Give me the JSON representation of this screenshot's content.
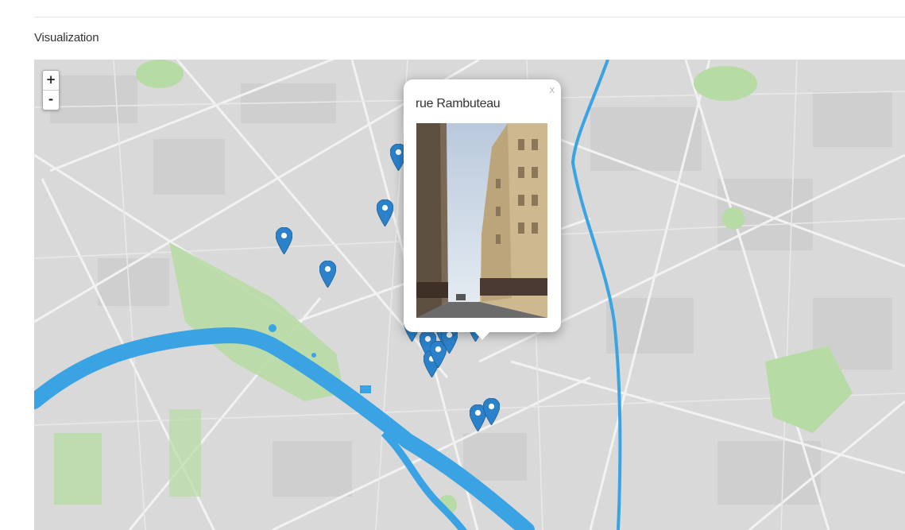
{
  "section": {
    "title": "Visualization"
  },
  "map": {
    "zoom_in_label": "+",
    "zoom_out_label": "-",
    "marker_color": "#2b82cb",
    "water_color": "#3aa3e3",
    "park_color": "#b7dba4",
    "marker_icon": "map-pin-icon",
    "markers": [
      {
        "id": 1
      },
      {
        "id": 2
      },
      {
        "id": 3
      },
      {
        "id": 4
      },
      {
        "id": 5
      },
      {
        "id": 6
      },
      {
        "id": 7
      },
      {
        "id": 8
      },
      {
        "id": 9
      },
      {
        "id": 10
      },
      {
        "id": 11
      },
      {
        "id": 12
      },
      {
        "id": 13
      },
      {
        "id": 14
      },
      {
        "id": 15
      },
      {
        "id": 16
      },
      {
        "id": 17
      }
    ]
  },
  "popup": {
    "title": "rue Rambuteau",
    "close_label": "x"
  }
}
